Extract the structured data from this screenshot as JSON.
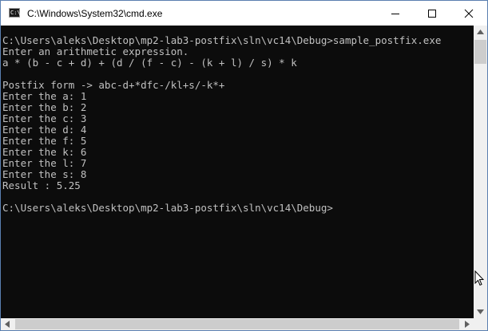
{
  "window": {
    "title": "C:\\Windows\\System32\\cmd.exe",
    "icon": "cmd-icon",
    "app_icon_glyph": "C:\\"
  },
  "controls": {
    "minimize": "minimize-icon",
    "maximize": "maximize-icon",
    "close": "close-icon"
  },
  "console": {
    "lines": [
      "C:\\Users\\aleks\\Desktop\\mp2-lab3-postfix\\sln\\vc14\\Debug>sample_postfix.exe",
      "Enter an arithmetic expression.",
      "a * (b - c + d) + (d / (f - c) - (k + l) / s) * k",
      "",
      "Postfix form -> abc-d+*dfc-/kl+s/-k*+",
      "Enter the a: 1",
      "Enter the b: 2",
      "Enter the c: 3",
      "Enter the d: 4",
      "Enter the f: 5",
      "Enter the k: 6",
      "Enter the l: 7",
      "Enter the s: 8",
      "Result : 5.25",
      "",
      "C:\\Users\\aleks\\Desktop\\mp2-lab3-postfix\\sln\\vc14\\Debug>"
    ],
    "background": "#0c0c0c",
    "text_color": "#c0c0c0"
  },
  "scrollbars": {
    "vertical": "vertical-scrollbar",
    "horizontal": "horizontal-scrollbar"
  }
}
